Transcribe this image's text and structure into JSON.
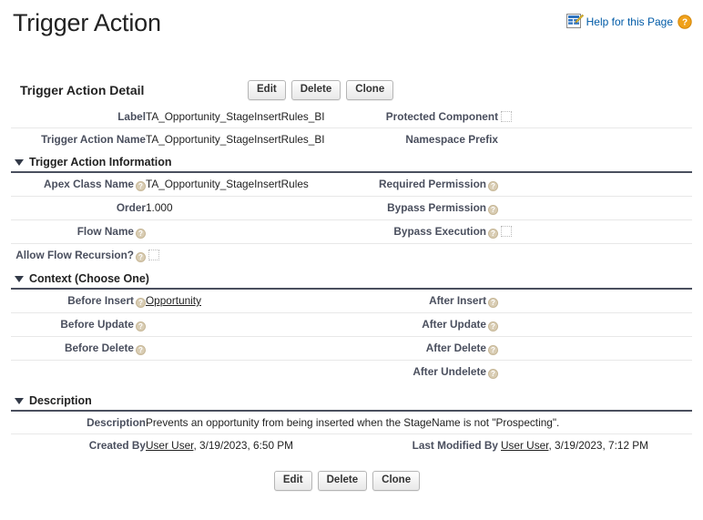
{
  "page": {
    "title": "Trigger Action",
    "help_icon": "document-edit-icon",
    "help_link_label": "Help for this Page",
    "help_question_icon": "question-mark-icon"
  },
  "detail_bar": {
    "title": "Trigger Action Detail",
    "buttons": [
      {
        "label": "Edit",
        "name": "edit-button"
      },
      {
        "label": "Delete",
        "name": "delete-button"
      },
      {
        "label": "Clone",
        "name": "clone-button"
      }
    ]
  },
  "top_fields": [
    {
      "left_label": "Label",
      "left_value": "TA_Opportunity_StageInsertRules_BI",
      "left_help": false,
      "right_label": "Protected Component",
      "right_help": false,
      "right_checkbox": true,
      "right_checked": false
    },
    {
      "left_label": "Trigger Action Name",
      "left_value": "TA_Opportunity_StageInsertRules_BI",
      "left_help": false,
      "right_label": "Namespace Prefix",
      "right_value": "",
      "right_help": false
    }
  ],
  "sections": [
    {
      "name": "trigger-action-information",
      "title": "Trigger Action Information",
      "expanded": true,
      "rows": [
        {
          "left_label": "Apex Class Name",
          "left_help": true,
          "left_value": "TA_Opportunity_StageInsertRules",
          "right_label": "Required Permission",
          "right_help": true,
          "right_value": ""
        },
        {
          "left_label": "Order",
          "left_help": false,
          "left_value": "1.000",
          "right_label": "Bypass Permission",
          "right_help": true,
          "right_value": ""
        },
        {
          "left_label": "Flow Name",
          "left_help": true,
          "left_value": "",
          "right_label": "Bypass Execution",
          "right_help": true,
          "right_checkbox": true,
          "right_checked": false
        },
        {
          "left_label": "Allow Flow Recursion?",
          "left_help": true,
          "left_checkbox": true,
          "left_checked": false,
          "right_label": "",
          "right_value": ""
        }
      ]
    },
    {
      "name": "context-choose-one",
      "title": "Context (Choose One)",
      "expanded": true,
      "rows": [
        {
          "left_label": "Before Insert",
          "left_help": true,
          "left_link": "Opportunity",
          "right_label": "After Insert",
          "right_help": true,
          "right_value": ""
        },
        {
          "left_label": "Before Update",
          "left_help": true,
          "left_value": "",
          "right_label": "After Update",
          "right_help": true,
          "right_value": ""
        },
        {
          "left_label": "Before Delete",
          "left_help": true,
          "left_value": "",
          "right_label": "After Delete",
          "right_help": true,
          "right_value": ""
        },
        {
          "left_label": "",
          "left_value": "",
          "right_label": "After Undelete",
          "right_help": true,
          "right_value": ""
        }
      ]
    }
  ],
  "description_section": {
    "name": "description",
    "title": "Description",
    "expanded": true,
    "description_label": "Description",
    "description_value": "Prevents an opportunity from being inserted when the StageName is not \"Prospecting\".",
    "created_by_label": "Created By",
    "created_by_user": "User User",
    "created_by_rest": ", 3/19/2023, 6:50 PM",
    "modified_by_label": "Last Modified By",
    "modified_by_user": "User User",
    "modified_by_rest": ", 3/19/2023, 7:12 PM"
  },
  "bottom_buttons": [
    {
      "label": "Edit",
      "name": "edit-button-bottom"
    },
    {
      "label": "Delete",
      "name": "delete-button-bottom"
    },
    {
      "label": "Clone",
      "name": "clone-button-bottom"
    }
  ],
  "colors": {
    "link": "#015ba7",
    "label": "#4a4f5e",
    "section_rule": "#4a4f5e",
    "help_bubble": "#d9cdb4",
    "help_question": "#f0a11a"
  }
}
